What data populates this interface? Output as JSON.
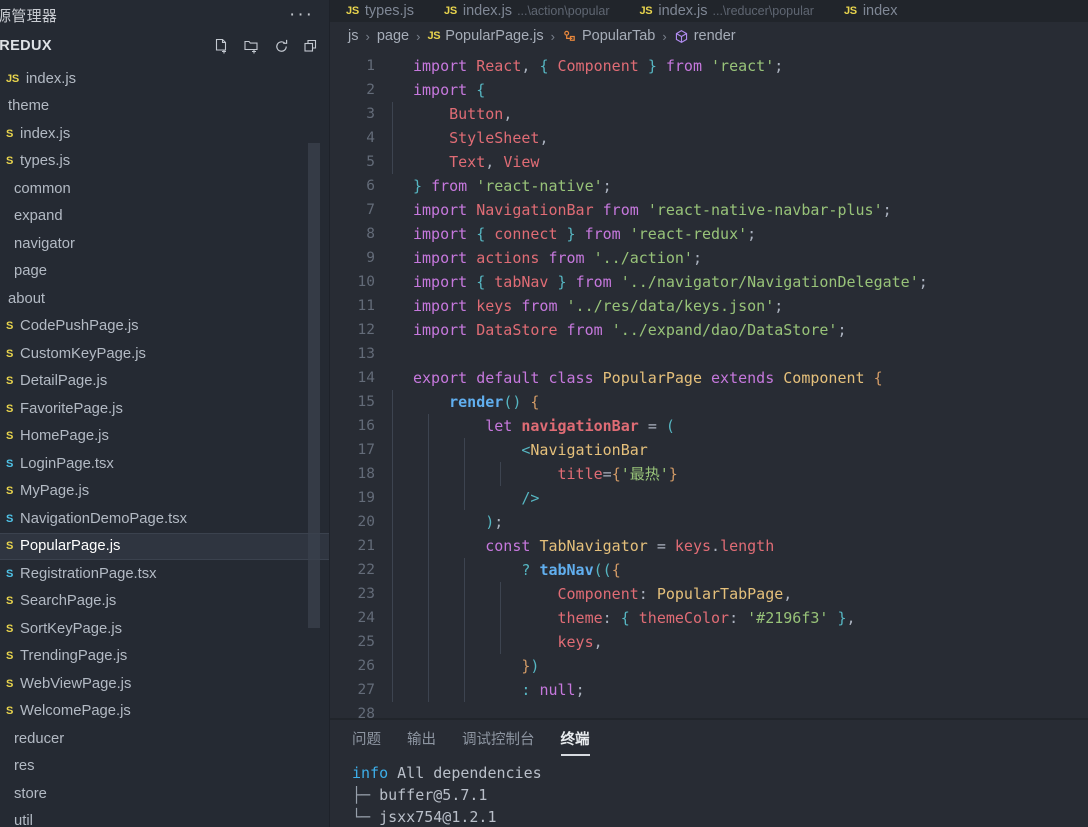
{
  "sidebar": {
    "title": "源管理器",
    "more_label": "···",
    "section_title": "-REDUX",
    "actions": [
      {
        "name": "new-file-icon",
        "label": "新建文件"
      },
      {
        "name": "new-folder-icon",
        "label": "新建文件夹"
      },
      {
        "name": "refresh-icon",
        "label": "刷新"
      },
      {
        "name": "collapse-all-icon",
        "label": "全部折叠"
      }
    ],
    "tree": [
      {
        "label": "index.js",
        "icon": "js",
        "indent": 1,
        "chevron": "",
        "selected": false
      },
      {
        "label": "theme",
        "icon": "",
        "indent": 0,
        "chevron": "›",
        "selected": false
      },
      {
        "label": "index.js",
        "icon": "js",
        "indent": 1,
        "chevron": "",
        "selected": false
      },
      {
        "label": "types.js",
        "icon": "js",
        "indent": 1,
        "chevron": "",
        "selected": false
      },
      {
        "label": "common",
        "icon": "",
        "indent": 1,
        "chevron": "",
        "selected": false
      },
      {
        "label": "expand",
        "icon": "",
        "indent": 1,
        "chevron": "",
        "selected": false
      },
      {
        "label": "navigator",
        "icon": "",
        "indent": 1,
        "chevron": "",
        "selected": false
      },
      {
        "label": "page",
        "icon": "",
        "indent": 1,
        "chevron": "",
        "selected": false
      },
      {
        "label": "about",
        "icon": "",
        "indent": 0,
        "chevron": "›",
        "selected": false
      },
      {
        "label": "CodePushPage.js",
        "icon": "js",
        "indent": 1,
        "chevron": "",
        "selected": false
      },
      {
        "label": "CustomKeyPage.js",
        "icon": "js",
        "indent": 1,
        "chevron": "",
        "selected": false
      },
      {
        "label": "DetailPage.js",
        "icon": "js",
        "indent": 1,
        "chevron": "",
        "selected": false
      },
      {
        "label": "FavoritePage.js",
        "icon": "js",
        "indent": 1,
        "chevron": "",
        "selected": false
      },
      {
        "label": "HomePage.js",
        "icon": "js",
        "indent": 1,
        "chevron": "",
        "selected": false
      },
      {
        "label": "LoginPage.tsx",
        "icon": "ts",
        "indent": 1,
        "chevron": "",
        "selected": false
      },
      {
        "label": "MyPage.js",
        "icon": "js",
        "indent": 1,
        "chevron": "",
        "selected": false
      },
      {
        "label": "NavigationDemoPage.tsx",
        "icon": "ts",
        "indent": 1,
        "chevron": "",
        "selected": false
      },
      {
        "label": "PopularPage.js",
        "icon": "js",
        "indent": 1,
        "chevron": "",
        "selected": true
      },
      {
        "label": "RegistrationPage.tsx",
        "icon": "ts",
        "indent": 1,
        "chevron": "",
        "selected": false
      },
      {
        "label": "SearchPage.js",
        "icon": "js",
        "indent": 1,
        "chevron": "",
        "selected": false
      },
      {
        "label": "SortKeyPage.js",
        "icon": "js",
        "indent": 1,
        "chevron": "",
        "selected": false
      },
      {
        "label": "TrendingPage.js",
        "icon": "js",
        "indent": 1,
        "chevron": "",
        "selected": false
      },
      {
        "label": "WebViewPage.js",
        "icon": "js",
        "indent": 1,
        "chevron": "",
        "selected": false
      },
      {
        "label": "WelcomePage.js",
        "icon": "js",
        "indent": 1,
        "chevron": "",
        "selected": false
      },
      {
        "label": "reducer",
        "icon": "",
        "indent": 1,
        "chevron": "",
        "selected": false
      },
      {
        "label": "res",
        "icon": "",
        "indent": 1,
        "chevron": "",
        "selected": false
      },
      {
        "label": "store",
        "icon": "",
        "indent": 1,
        "chevron": "",
        "selected": false
      },
      {
        "label": "util",
        "icon": "",
        "indent": 1,
        "chevron": "",
        "selected": false
      }
    ]
  },
  "editor": {
    "tabs": [
      {
        "icon": "JS",
        "label": "types.js",
        "desc": "",
        "active": false
      },
      {
        "icon": "JS",
        "label": "index.js",
        "desc": "...\\action\\popular",
        "active": false
      },
      {
        "icon": "JS",
        "label": "index.js",
        "desc": "...\\reducer\\popular",
        "active": false
      },
      {
        "icon": "JS",
        "label": "index",
        "desc": "",
        "active": false
      }
    ],
    "breadcrumb": [
      {
        "label": "js",
        "icon": ""
      },
      {
        "label": "page",
        "icon": ""
      },
      {
        "label": "PopularPage.js",
        "icon": "js"
      },
      {
        "label": "PopularTab",
        "icon": "class"
      },
      {
        "label": "render",
        "icon": "method"
      }
    ],
    "lines": [
      {
        "n": 1,
        "indents": 0,
        "tokens": [
          [
            "t-key",
            "import"
          ],
          [
            "t-plain",
            " "
          ],
          [
            "t-var",
            "React"
          ],
          [
            "t-punc",
            ", "
          ],
          [
            "t-brc",
            "{"
          ],
          [
            "t-plain",
            " "
          ],
          [
            "t-var",
            "Component"
          ],
          [
            "t-plain",
            " "
          ],
          [
            "t-brc",
            "}"
          ],
          [
            "t-plain",
            " "
          ],
          [
            "t-key",
            "from"
          ],
          [
            "t-plain",
            " "
          ],
          [
            "t-str",
            "'react'"
          ],
          [
            "t-punc",
            ";"
          ]
        ]
      },
      {
        "n": 2,
        "indents": 0,
        "tokens": [
          [
            "t-key",
            "import"
          ],
          [
            "t-plain",
            " "
          ],
          [
            "t-brc",
            "{"
          ]
        ]
      },
      {
        "n": 3,
        "indents": 1,
        "tokens": [
          [
            "t-plain",
            "    "
          ],
          [
            "t-var",
            "Button"
          ],
          [
            "t-punc",
            ","
          ]
        ]
      },
      {
        "n": 4,
        "indents": 1,
        "tokens": [
          [
            "t-plain",
            "    "
          ],
          [
            "t-var",
            "StyleSheet"
          ],
          [
            "t-punc",
            ","
          ]
        ]
      },
      {
        "n": 5,
        "indents": 1,
        "tokens": [
          [
            "t-plain",
            "    "
          ],
          [
            "t-var",
            "Text"
          ],
          [
            "t-punc",
            ", "
          ],
          [
            "t-var",
            "View"
          ]
        ]
      },
      {
        "n": 6,
        "indents": 0,
        "tokens": [
          [
            "t-brc",
            "}"
          ],
          [
            "t-plain",
            " "
          ],
          [
            "t-key",
            "from"
          ],
          [
            "t-plain",
            " "
          ],
          [
            "t-str",
            "'react-native'"
          ],
          [
            "t-punc",
            ";"
          ]
        ]
      },
      {
        "n": 7,
        "indents": 0,
        "tokens": [
          [
            "t-key",
            "import"
          ],
          [
            "t-plain",
            " "
          ],
          [
            "t-var",
            "NavigationBar"
          ],
          [
            "t-plain",
            " "
          ],
          [
            "t-key",
            "from"
          ],
          [
            "t-plain",
            " "
          ],
          [
            "t-str",
            "'react-native-navbar-plus'"
          ],
          [
            "t-punc",
            ";"
          ]
        ]
      },
      {
        "n": 8,
        "indents": 0,
        "tokens": [
          [
            "t-key",
            "import"
          ],
          [
            "t-plain",
            " "
          ],
          [
            "t-brc",
            "{"
          ],
          [
            "t-plain",
            " "
          ],
          [
            "t-var",
            "connect"
          ],
          [
            "t-plain",
            " "
          ],
          [
            "t-brc",
            "}"
          ],
          [
            "t-plain",
            " "
          ],
          [
            "t-key",
            "from"
          ],
          [
            "t-plain",
            " "
          ],
          [
            "t-str",
            "'react-redux'"
          ],
          [
            "t-punc",
            ";"
          ]
        ]
      },
      {
        "n": 9,
        "indents": 0,
        "tokens": [
          [
            "t-key",
            "import"
          ],
          [
            "t-plain",
            " "
          ],
          [
            "t-var",
            "actions"
          ],
          [
            "t-plain",
            " "
          ],
          [
            "t-key",
            "from"
          ],
          [
            "t-plain",
            " "
          ],
          [
            "t-str",
            "'../action'"
          ],
          [
            "t-punc",
            ";"
          ]
        ]
      },
      {
        "n": 10,
        "indents": 0,
        "tokens": [
          [
            "t-key",
            "import"
          ],
          [
            "t-plain",
            " "
          ],
          [
            "t-brc",
            "{"
          ],
          [
            "t-plain",
            " "
          ],
          [
            "t-var",
            "tabNav"
          ],
          [
            "t-plain",
            " "
          ],
          [
            "t-brc",
            "}"
          ],
          [
            "t-plain",
            " "
          ],
          [
            "t-key",
            "from"
          ],
          [
            "t-plain",
            " "
          ],
          [
            "t-str",
            "'../navigator/NavigationDelegate'"
          ],
          [
            "t-punc",
            ";"
          ]
        ]
      },
      {
        "n": 11,
        "indents": 0,
        "tokens": [
          [
            "t-key",
            "import"
          ],
          [
            "t-plain",
            " "
          ],
          [
            "t-var",
            "keys"
          ],
          [
            "t-plain",
            " "
          ],
          [
            "t-key",
            "from"
          ],
          [
            "t-plain",
            " "
          ],
          [
            "t-str",
            "'../res/data/keys.json'"
          ],
          [
            "t-punc",
            ";"
          ]
        ]
      },
      {
        "n": 12,
        "indents": 0,
        "tokens": [
          [
            "t-key",
            "import"
          ],
          [
            "t-plain",
            " "
          ],
          [
            "t-var",
            "DataStore"
          ],
          [
            "t-plain",
            " "
          ],
          [
            "t-key",
            "from"
          ],
          [
            "t-plain",
            " "
          ],
          [
            "t-str",
            "'../expand/dao/DataStore'"
          ],
          [
            "t-punc",
            ";"
          ]
        ]
      },
      {
        "n": 13,
        "indents": 0,
        "tokens": []
      },
      {
        "n": 14,
        "indents": 0,
        "tokens": [
          [
            "t-key",
            "export"
          ],
          [
            "t-plain",
            " "
          ],
          [
            "t-key",
            "default"
          ],
          [
            "t-plain",
            " "
          ],
          [
            "t-key",
            "class"
          ],
          [
            "t-plain",
            " "
          ],
          [
            "t-cls",
            "PopularPage"
          ],
          [
            "t-plain",
            " "
          ],
          [
            "t-key",
            "extends"
          ],
          [
            "t-plain",
            " "
          ],
          [
            "t-cls",
            "Component"
          ],
          [
            "t-plain",
            " "
          ],
          [
            "t-brc2",
            "{"
          ]
        ]
      },
      {
        "n": 15,
        "indents": 1,
        "tokens": [
          [
            "t-plain",
            "    "
          ],
          [
            "t-fn",
            "render"
          ],
          [
            "t-brc",
            "()"
          ],
          [
            "t-plain",
            " "
          ],
          [
            "t-brc2",
            "{"
          ]
        ]
      },
      {
        "n": 16,
        "indents": 2,
        "tokens": [
          [
            "t-plain",
            "        "
          ],
          [
            "t-key",
            "let"
          ],
          [
            "t-plain",
            " "
          ],
          [
            "t-bold-var",
            "navigationBar"
          ],
          [
            "t-plain",
            " "
          ],
          [
            "t-punc",
            "="
          ],
          [
            "t-plain",
            " "
          ],
          [
            "t-brc",
            "("
          ]
        ]
      },
      {
        "n": 17,
        "indents": 3,
        "tokens": [
          [
            "t-plain",
            "            "
          ],
          [
            "t-brc",
            "<"
          ],
          [
            "t-cls",
            "NavigationBar"
          ]
        ]
      },
      {
        "n": 18,
        "indents": 4,
        "tokens": [
          [
            "t-plain",
            "                "
          ],
          [
            "t-var",
            "title"
          ],
          [
            "t-punc",
            "="
          ],
          [
            "t-brc2",
            "{"
          ],
          [
            "t-str",
            "'最热'"
          ],
          [
            "t-brc2",
            "}"
          ]
        ]
      },
      {
        "n": 19,
        "indents": 3,
        "tokens": [
          [
            "t-plain",
            "            "
          ],
          [
            "t-brc",
            "/>"
          ]
        ]
      },
      {
        "n": 20,
        "indents": 2,
        "tokens": [
          [
            "t-plain",
            "        "
          ],
          [
            "t-brc",
            ")"
          ],
          [
            "t-punc",
            ";"
          ]
        ]
      },
      {
        "n": 21,
        "indents": 2,
        "tokens": [
          [
            "t-plain",
            "        "
          ],
          [
            "t-key",
            "const"
          ],
          [
            "t-plain",
            " "
          ],
          [
            "t-cls",
            "TabNavigator"
          ],
          [
            "t-plain",
            " "
          ],
          [
            "t-punc",
            "="
          ],
          [
            "t-plain",
            " "
          ],
          [
            "t-var",
            "keys"
          ],
          [
            "t-punc",
            "."
          ],
          [
            "t-prop",
            "length"
          ]
        ]
      },
      {
        "n": 22,
        "indents": 3,
        "tokens": [
          [
            "t-plain",
            "            "
          ],
          [
            "t-brc",
            "?"
          ],
          [
            "t-plain",
            " "
          ],
          [
            "t-fn",
            "tabNav"
          ],
          [
            "t-brc",
            "(("
          ],
          [
            "t-brc2",
            "{"
          ]
        ]
      },
      {
        "n": 23,
        "indents": 4,
        "tokens": [
          [
            "t-plain",
            "                "
          ],
          [
            "t-prop",
            "Component"
          ],
          [
            "t-punc",
            ": "
          ],
          [
            "t-cls",
            "PopularTabPage"
          ],
          [
            "t-punc",
            ","
          ]
        ]
      },
      {
        "n": 24,
        "indents": 4,
        "tokens": [
          [
            "t-plain",
            "                "
          ],
          [
            "t-prop",
            "theme"
          ],
          [
            "t-punc",
            ": "
          ],
          [
            "t-brc",
            "{"
          ],
          [
            "t-plain",
            " "
          ],
          [
            "t-prop",
            "themeColor"
          ],
          [
            "t-punc",
            ": "
          ],
          [
            "t-str",
            "'#2196f3'"
          ],
          [
            "t-plain",
            " "
          ],
          [
            "t-brc",
            "}"
          ],
          [
            "t-punc",
            ","
          ]
        ]
      },
      {
        "n": 25,
        "indents": 4,
        "tokens": [
          [
            "t-plain",
            "                "
          ],
          [
            "t-prop",
            "keys"
          ],
          [
            "t-punc",
            ","
          ]
        ]
      },
      {
        "n": 26,
        "indents": 3,
        "tokens": [
          [
            "t-plain",
            "            "
          ],
          [
            "t-brc2",
            "}"
          ],
          [
            "t-brc",
            ")"
          ]
        ]
      },
      {
        "n": 27,
        "indents": 3,
        "tokens": [
          [
            "t-plain",
            "            "
          ],
          [
            "t-brc",
            ":"
          ],
          [
            "t-plain",
            " "
          ],
          [
            "t-key",
            "null"
          ],
          [
            "t-punc",
            ";"
          ]
        ]
      },
      {
        "n": 28,
        "indents": 0,
        "tokens": []
      }
    ]
  },
  "panel": {
    "tabs": [
      {
        "label": "问题",
        "active": false
      },
      {
        "label": "输出",
        "active": false
      },
      {
        "label": "调试控制台",
        "active": false
      },
      {
        "label": "终端",
        "active": true
      }
    ],
    "terminal": [
      {
        "prefix": "info",
        "text": " All dependencies",
        "tree": ""
      },
      {
        "prefix": "",
        "text": "buffer@5.7.1",
        "tree": "├─ "
      },
      {
        "prefix": "",
        "text": "jsxx754@1.2.1",
        "tree": "└─ "
      }
    ]
  },
  "colors": {
    "sidebar_bg": "#252a33",
    "editor_bg": "#282c34",
    "tabbar_bg": "#21252b",
    "accent": "#3daee9",
    "selected_row": "#2f3540",
    "theme_color_value": "#2196f3"
  }
}
